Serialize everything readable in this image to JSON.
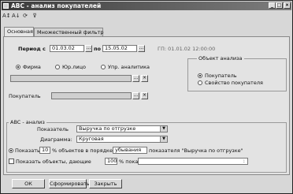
{
  "window": {
    "title": "ABC - анализ покупателей",
    "controls": [
      "_",
      "□",
      "×"
    ]
  },
  "toolbar": {
    "icons": [
      "sort-asc-icon",
      "sort-desc-icon",
      "refresh-icon",
      "filter-icon"
    ]
  },
  "tabs": [
    {
      "label": "Основная",
      "active": true
    },
    {
      "label": "Множественный фильтр",
      "active": false
    }
  ],
  "period": {
    "label": "Период с",
    "from": "01.03.02",
    "to_label": "по",
    "to": "15.05.02",
    "gp_text": "ГП:  01.01.02 12:00:00"
  },
  "entity": {
    "options": [
      "Фирма",
      "Юр.лицо",
      "Упр. аналитика"
    ],
    "selected": "Фирма"
  },
  "buyer": {
    "label": "Покупатель"
  },
  "analysis_object": {
    "title": "Объект анализа",
    "options": [
      "Покупатель",
      "Свойство покупателя"
    ],
    "selected": "Покупатель"
  },
  "abc": {
    "title": "ABC - анализ",
    "indicator_label": "Показатель",
    "indicator_value": "Выручка по отгрузке",
    "diagram_label": "Диаграмма:",
    "diagram_value": "Круговая",
    "show_label": "Показать",
    "show_count": "10",
    "show_mid": "% объектов в порядке",
    "order_value": "убывания",
    "indicator_tail": "показателя \"Выручка по отгрузке\"",
    "show_objects_label": "Показать объекты, дающие",
    "objects_percent": "100",
    "objects_mid": "% пока",
    "objects_tail": ":"
  },
  "buttons": {
    "ok": "ОК",
    "form": "Сформировать",
    "close": "Закрыть"
  }
}
